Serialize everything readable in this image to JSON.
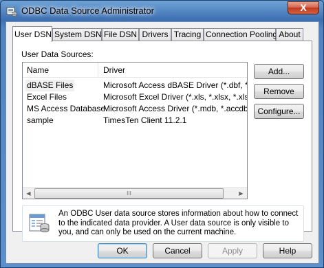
{
  "window": {
    "title": "ODBC Data Source Administrator",
    "close_label": "X"
  },
  "tabs": [
    {
      "label": "User DSN"
    },
    {
      "label": "System DSN"
    },
    {
      "label": "File DSN"
    },
    {
      "label": "Drivers"
    },
    {
      "label": "Tracing"
    },
    {
      "label": "Connection Pooling"
    },
    {
      "label": "About"
    }
  ],
  "user_dsn": {
    "section_label": "User Data Sources:",
    "columns": [
      "Name",
      "Driver"
    ],
    "rows": [
      {
        "name": "dBASE Files",
        "driver": "Microsoft Access dBASE Driver (*.dbf, *.ndx"
      },
      {
        "name": "Excel Files",
        "driver": "Microsoft Excel Driver (*.xls, *.xlsx, *.xlsm, *.x"
      },
      {
        "name": "MS Access Database",
        "driver": "Microsoft Access Driver (*.mdb, *.accdb)"
      },
      {
        "name": "sample",
        "driver": "TimesTen Client 11.2.1"
      }
    ],
    "scroll_grip": "III",
    "buttons": {
      "add": "Add...",
      "remove": "Remove",
      "configure": "Configure..."
    },
    "info_text": "An ODBC User data source stores information about how to connect to the indicated data provider.   A User data source is only visible to you, and can only be used on the current machine."
  },
  "dialog_buttons": {
    "ok": "OK",
    "cancel": "Cancel",
    "apply": "Apply",
    "help": "Help"
  },
  "icons": {
    "title": "odbc-icon",
    "info": "datasource-icon"
  }
}
